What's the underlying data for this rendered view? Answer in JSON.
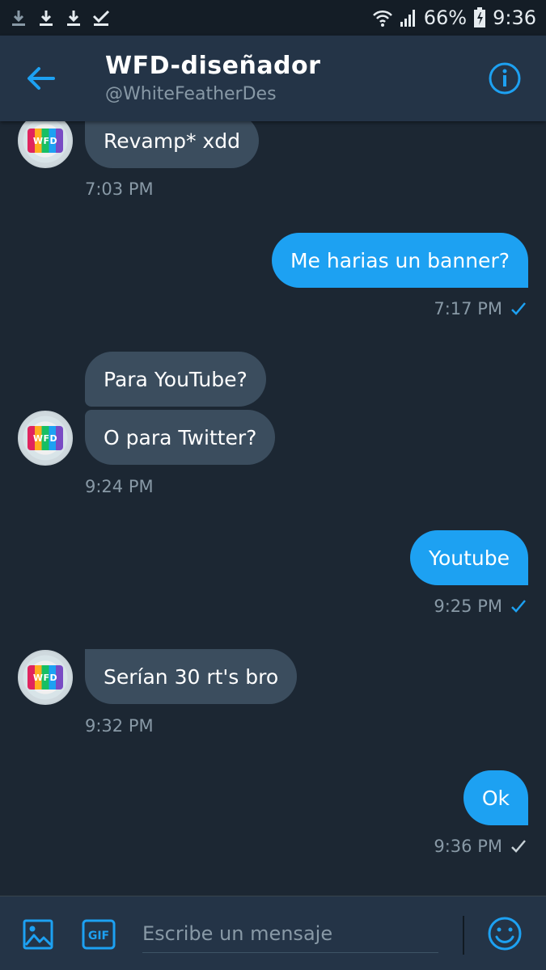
{
  "status_bar": {
    "notification_icons": [
      "download-icon",
      "download-icon",
      "download-icon",
      "check-icon"
    ],
    "battery": "66%",
    "time": "9:36"
  },
  "header": {
    "title": "WFD-diseñador",
    "handle": "@WhiteFeatherDes"
  },
  "avatar_text": "WFD",
  "messages": [
    {
      "direction": "in",
      "text": "Revamp* xdd",
      "time": "7:03 PM"
    },
    {
      "direction": "out",
      "text": "Me harias un banner?",
      "time": "7:17 PM",
      "status": "read"
    },
    {
      "direction": "in",
      "text": "Para YouTube?"
    },
    {
      "direction": "in",
      "text": "O para Twitter?",
      "time": "9:24 PM"
    },
    {
      "direction": "out",
      "text": "Youtube",
      "time": "9:25 PM",
      "status": "read"
    },
    {
      "direction": "in",
      "text": "Serían 30 rt's bro",
      "time": "9:32 PM"
    },
    {
      "direction": "out",
      "text": "Ok",
      "time": "9:36 PM",
      "status": "sent"
    }
  ],
  "composer": {
    "placeholder": "Escribe un mensaje",
    "gif_label": "GIF"
  },
  "colors": {
    "background": "#1c2733",
    "header": "#243447",
    "accent": "#1da1f2",
    "incoming_bubble": "#3b4d5e",
    "muted_text": "#8899a6"
  }
}
